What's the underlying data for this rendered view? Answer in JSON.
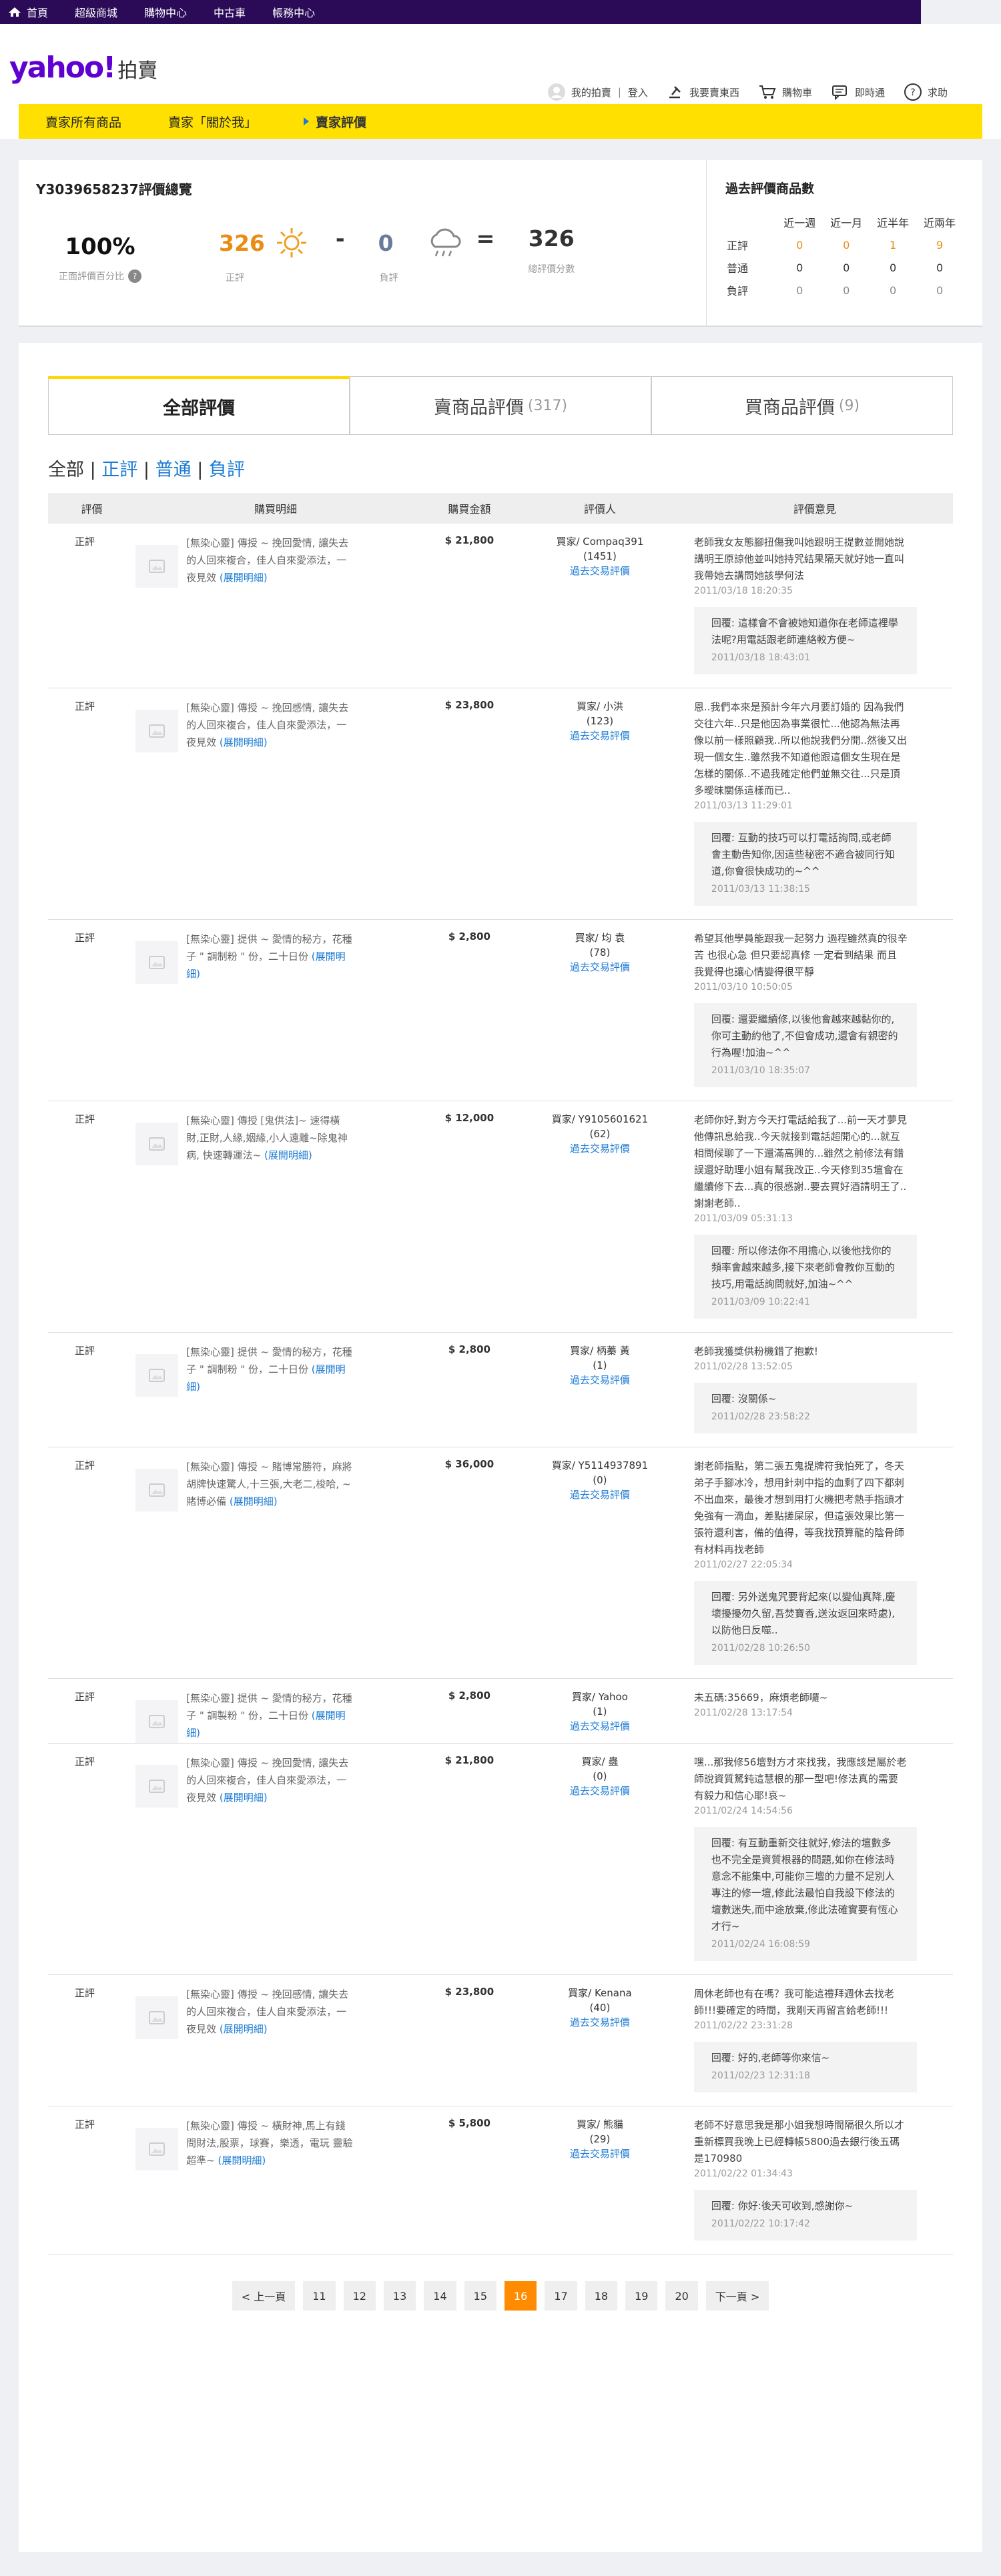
{
  "topnav": {
    "items": [
      "首頁",
      "超級商城",
      "購物中心",
      "中古車",
      "帳務中心"
    ]
  },
  "header": {
    "logo": "yahoo!",
    "logo_sub": "拍賣",
    "my_auction": "我的拍賣",
    "login": "登入",
    "sell": "我要賣東西",
    "cart": "購物車",
    "im": "即時通",
    "help": "求助"
  },
  "crumbs": {
    "all_items": "賣家所有商品",
    "about": "賣家「關於我」",
    "rating": "賣家評價"
  },
  "summary": {
    "title": "Y3039658237評價總覽",
    "pct": "100%",
    "pct_label": "正面評價百分比",
    "pos": "326",
    "pos_label": "正評",
    "minus": "-",
    "neg": "0",
    "neg_label": "負評",
    "eq": "=",
    "total": "326",
    "total_label": "總評價分數"
  },
  "past": {
    "title": "過去評價商品數",
    "cols": [
      "近一週",
      "近一月",
      "近半年",
      "近兩年"
    ],
    "rows": [
      {
        "label": "正評",
        "vals": [
          "0",
          "0",
          "1",
          "9"
        ]
      },
      {
        "label": "普通",
        "vals": [
          "0",
          "0",
          "0",
          "0"
        ]
      },
      {
        "label": "負評",
        "vals": [
          "0",
          "0",
          "0",
          "0"
        ]
      }
    ]
  },
  "tabs": {
    "all": "全部評價",
    "sell": "賣商品評價",
    "sell_cnt": "(317)",
    "buy": "買商品評價",
    "buy_cnt": "(9)"
  },
  "filter": {
    "all": "全部",
    "pos": "正評",
    "mid": "普通",
    "neg": "負評",
    "bar": "|"
  },
  "columns": {
    "c1": "評價",
    "c2": "購買明細",
    "c3": "購買金額",
    "c4": "評價人",
    "c5": "評價意見"
  },
  "rows": [
    {
      "rate": "正評",
      "desc": "[無染心靈] 傳授 ~ 挽回愛情, 讓失去的人回來複合，佳人自來愛添法，一夜見效",
      "more": "(展開明細)",
      "amt": "$ 21,800",
      "rater": "買家/ Compaq391",
      "score": "(1451)",
      "past_link": "過去交易評價",
      "comment": "老師我女友態腳扭傷我叫她跟明王提數並開她說講明王原諒他並叫她持咒結果隔天就好她一直叫我帶她去講問她該學何法",
      "date": "2011/03/18 18:20:35",
      "reply": "回覆: 這樣會不會被她知道你在老師這裡學法呢?用電話跟老師連絡較方便~",
      "reply_date": "2011/03/18 18:43:01"
    },
    {
      "rate": "正評",
      "desc": "[無染心靈] 傳授 ~ 挽回感情, 讓失去的人回來複合，佳人自來愛添法，一夜見效",
      "more": "(展開明細)",
      "amt": "$ 23,800",
      "rater": "買家/ 小洪",
      "score": "(123)",
      "past_link": "過去交易評價",
      "comment": "恩..我們本來是預計今年六月要訂婚的 因為我們交往六年..只是他因為事業很忙...他認為無法再像以前一樣照顧我..所以他說我們分開..然後又出現一個女生..雖然我不知道他跟這個女生現在是怎樣的關係..不過我確定他們並無交往...只是頂多曖昧關係這樣而已..",
      "date": "2011/03/13 11:29:01",
      "reply": "回覆: 互動的技巧可以打電話詢問,或老師會主動告知你,因這些秘密不適合被同行知道,你會很快成功的~^^",
      "reply_date": "2011/03/13 11:38:15"
    },
    {
      "rate": "正評",
      "desc": "[無染心靈] 提供 ~ 愛情的秘方，花種子 \" 調制粉 \" 份，二十日份",
      "more": "(展開明細)",
      "amt": "$ 2,800",
      "rater": "買家/ 均 袁",
      "score": "(78)",
      "past_link": "過去交易評價",
      "comment": "希望其他學員能跟我一起努力 過程雖然真的很辛苦 也很心急 但只要認真修 一定看到結果 而且 我覺得也讓心情變得很平靜",
      "date": "2011/03/10 10:50:05",
      "reply": "回覆: 還要繼續修,以後他會越來越黏你的,你可主動約他了,不但會成功,還會有親密的行為喔!加油~^^",
      "reply_date": "2011/03/10 18:35:07"
    },
    {
      "rate": "正評",
      "desc": "[無染心靈] 傳授 [鬼供法]~ 速得橫財,正財,人緣,姻緣,小人遠離~除鬼神病, 快速轉運法~",
      "more": "(展開明細)",
      "amt": "$ 12,000",
      "rater": "買家/ Y9105601621",
      "score": "(62)",
      "past_link": "過去交易評價",
      "comment": "老師你好,對方今天打電話給我了...前一天才夢見他傳訊息給我..今天就接到電話超開心的...就互相問候聊了一下還滿高興的...雖然之前修法有錯誤還好助理小姐有幫我改正..今天修到35壇會在繼續修下去...真的很感謝..要去買好酒請明王了..謝謝老師..",
      "date": "2011/03/09 05:31:13",
      "reply": "回覆: 所以修法你不用擔心,以後他找你的頻率會越來越多,接下來老師會教你互動的技巧,用電話詢問就好,加油~^^",
      "reply_date": "2011/03/09 10:22:41"
    },
    {
      "rate": "正評",
      "desc": "[無染心靈] 提供 ~ 愛情的秘方，花種子 \" 調制粉 \" 份，二十日份",
      "more": "(展開明細)",
      "amt": "$ 2,800",
      "rater": "買家/ 柄蓁 黃",
      "score": "(1)",
      "past_link": "過去交易評價",
      "comment": "老師我獲獎供粉機錯了抱歉!",
      "date": "2011/02/28 13:52:05",
      "reply": "回覆: 沒關係~",
      "reply_date": "2011/02/28 23:58:22"
    },
    {
      "rate": "正評",
      "desc": "[無染心靈] 傳授 ~ 賭博常勝符，麻將胡牌快速驚人,十三張,大老二,梭哈, ~賭博必備",
      "more": "(展開明細)",
      "amt": "$ 36,000",
      "rater": "買家/ Y5114937891",
      "score": "(0)",
      "past_link": "過去交易評價",
      "comment": "謝老師指點，第二張五鬼提牌符我怕死了，冬天弟子手腳冰冷，想用針刺中指的血剩了四下都刺不出血來，最後才想到用打火機把考熱手指頭才免強有一滴血，差點搓屎尿，但這張效果比第一張符還利害，備的值得，等我找預算龍的陰骨師有材料再找老師",
      "date": "2011/02/27 22:05:34",
      "reply": "回覆: 另外送鬼咒要背起來(以變仙真降,慶壞擾擾勿久留,吾焚寶香,送汝返回來時處),以防他日反噬..",
      "reply_date": "2011/02/28 10:26:50"
    },
    {
      "rate": "正評",
      "desc": "[無染心靈] 提供 ~ 愛情的秘方，花種子 \" 調製粉 \" 份，二十日份",
      "more": "(展開明細)",
      "amt": "$ 2,800",
      "rater": "買家/ Yahoo",
      "score": "(1)",
      "past_link": "過去交易評價",
      "comment": "未五碼:35669，麻煩老師囉~",
      "date": "2011/02/28 13:17:54",
      "reply": "",
      "reply_date": ""
    },
    {
      "rate": "正評",
      "desc": "[無染心靈] 傳授 ~ 挽回愛情, 讓失去的人回來複合，佳人自來愛添法，一夜見效",
      "more": "(展開明細)",
      "amt": "$ 21,800",
      "rater": "買家/ 蟲",
      "score": "(0)",
      "past_link": "過去交易評價",
      "comment": "嘿...那我修56壇對方才來找我，我應該是屬於老師說資質駑鈍這慧根的那一型吧!修法真的需要有毅力和信心耶!哀~",
      "date": "2011/02/24 14:54:56",
      "reply": "回覆: 有互動重新交往就好,修法的壇數多也不完全是資質根器的問題,如你在修法時意念不能集中,可能你三壇的力量不足別人專注的修一壇,修此法最怕自我設下修法的壇數迷失,而中途放棄,修此法確實要有恆心才行~",
      "reply_date": "2011/02/24 16:08:59"
    },
    {
      "rate": "正評",
      "desc": "[無染心靈] 傳授 ~ 挽回感情, 讓失去的人回來複合，佳人自來愛添法，一夜見效",
      "more": "(展開明細)",
      "amt": "$ 23,800",
      "rater": "買家/ Kenana",
      "score": "(40)",
      "past_link": "過去交易評價",
      "comment": "周休老師也有在嗎？我可能這禮拜週休去找老師!!!要確定的時間，我剛天再留言給老師!!!",
      "date": "2011/02/22 23:31:28",
      "reply": "回覆: 好的,老師等你來信~",
      "reply_date": "2011/02/23 12:31:18"
    },
    {
      "rate": "正評",
      "desc": "[無染心靈] 傳授 ~ 橫財神,馬上有錢問財法,股票，球賽，樂透，電玩 靈驗超準~",
      "more": "(展開明細)",
      "amt": "$ 5,800",
      "rater": "買家/ 熊貓",
      "score": "(29)",
      "past_link": "過去交易評價",
      "comment": "老師不好意思我是那小姐我想時間隔很久所以才重新標買我晚上已經轉帳5800過去銀行後五碼是170980",
      "date": "2011/02/22 01:34:43",
      "reply": "回覆: 你好:後天可收到,感謝你~",
      "reply_date": "2011/02/22 10:17:42"
    }
  ],
  "pager": {
    "prev": "< 上一頁",
    "pages": [
      "11",
      "12",
      "13",
      "14",
      "15",
      "16",
      "17",
      "18",
      "19",
      "20"
    ],
    "current": "16",
    "next": "下一頁 >"
  },
  "colors": {
    "purple": "#2b0a58",
    "yellow": "#ffe000",
    "orange": "#e98d15",
    "link": "#1a7ad4",
    "pager_active": "#ff8b00"
  }
}
